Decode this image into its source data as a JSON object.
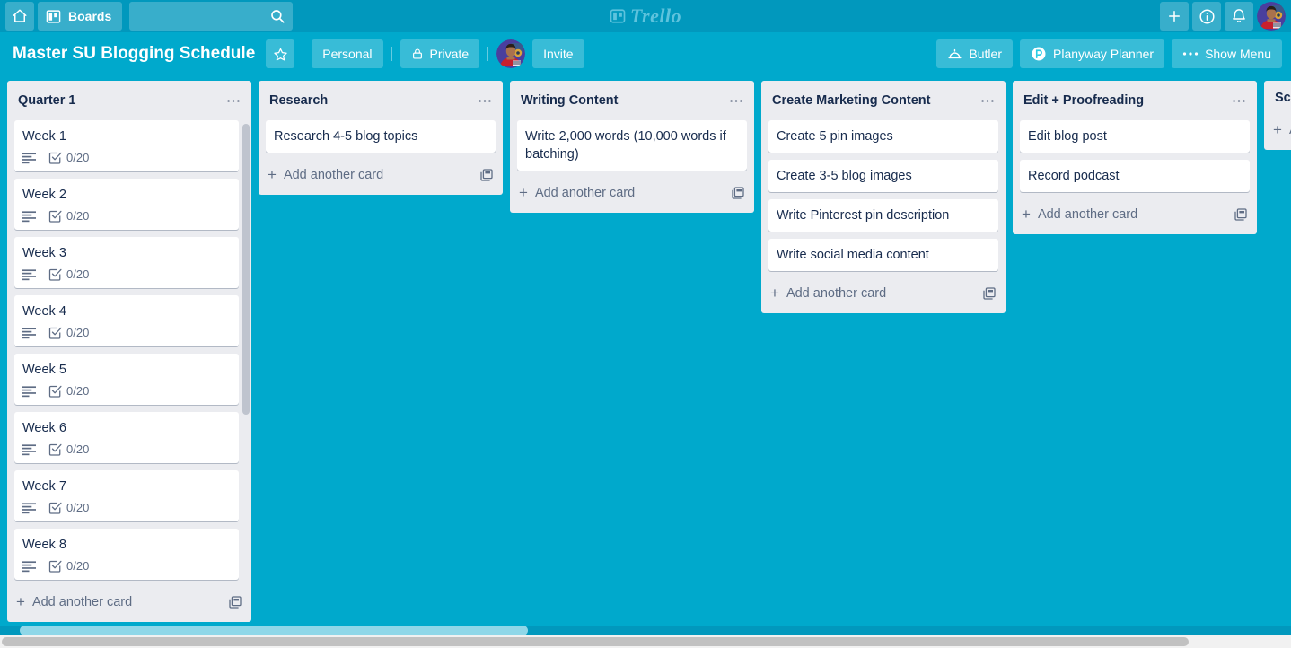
{
  "top_nav": {
    "home_icon": "home-icon",
    "boards_label": "Boards",
    "boards_icon": "boards-grid-icon",
    "search_placeholder": "",
    "search_value": "",
    "search_icon": "search-icon",
    "logo_text": "Trello",
    "logo_icon": "trello-logo-icon",
    "add_icon": "plus-icon",
    "info_icon": "info-circle-icon",
    "notifications_icon": "bell-icon",
    "avatar": "user-avatar"
  },
  "board_bar": {
    "title": "Master SU Blogging Schedule",
    "star_icon": "star-icon",
    "team_label": "Personal",
    "visibility_label": "Private",
    "lock_icon": "lock-icon",
    "member_avatar": "member-avatar",
    "invite_label": "Invite",
    "butler_label": "Butler",
    "butler_icon": "butler-dome-icon",
    "planyway_label": "Planyway Planner",
    "planyway_icon": "planyway-logo-icon",
    "show_menu_label": "Show Menu",
    "show_menu_icon": "ellipsis-icon"
  },
  "common": {
    "add_another_card": "Add another card",
    "add_card": "Add a card",
    "plus": "+",
    "list_menu_icon": "ellipsis-icon",
    "card_template_icon": "card-template-icon",
    "description_icon": "description-icon",
    "checklist_icon": "checklist-icon"
  },
  "colors": {
    "board_background": "#00a9cc",
    "top_nav": "#0198bd",
    "list_background": "#ebecf0",
    "card_background": "#ffffff",
    "text_primary": "#172b4d",
    "text_muted": "#5e6c84"
  },
  "lists": [
    {
      "title": "Quarter 1",
      "scrollable": true,
      "cards": [
        {
          "title": "Week 1",
          "checklist": "0/20",
          "has_description": true
        },
        {
          "title": "Week 2",
          "checklist": "0/20",
          "has_description": true
        },
        {
          "title": "Week 3",
          "checklist": "0/20",
          "has_description": true
        },
        {
          "title": "Week 4",
          "checklist": "0/20",
          "has_description": true
        },
        {
          "title": "Week 5",
          "checklist": "0/20",
          "has_description": true
        },
        {
          "title": "Week 6",
          "checklist": "0/20",
          "has_description": true
        },
        {
          "title": "Week 7",
          "checklist": "0/20",
          "has_description": true
        },
        {
          "title": "Week 8",
          "checklist": "0/20",
          "has_description": true
        }
      ]
    },
    {
      "title": "Research",
      "scrollable": false,
      "cards": [
        {
          "title": "Research 4-5 blog topics",
          "checklist": "",
          "has_description": false
        }
      ]
    },
    {
      "title": "Writing Content",
      "scrollable": false,
      "cards": [
        {
          "title": "Write 2,000 words (10,000 words if batching)",
          "checklist": "",
          "has_description": false
        }
      ]
    },
    {
      "title": "Create Marketing Content",
      "scrollable": false,
      "cards": [
        {
          "title": "Create 5 pin images",
          "checklist": "",
          "has_description": false
        },
        {
          "title": "Create 3-5 blog images",
          "checklist": "",
          "has_description": false
        },
        {
          "title": "Write Pinterest pin description",
          "checklist": "",
          "has_description": false
        },
        {
          "title": "Write social media content",
          "checklist": "",
          "has_description": false
        }
      ]
    },
    {
      "title": "Edit + Proofreading",
      "scrollable": false,
      "cards": [
        {
          "title": "Edit blog post",
          "checklist": "",
          "has_description": false
        },
        {
          "title": "Record podcast",
          "checklist": "",
          "has_description": false
        }
      ]
    },
    {
      "title": "Sc",
      "scrollable": false,
      "partial": true,
      "cards": []
    }
  ]
}
